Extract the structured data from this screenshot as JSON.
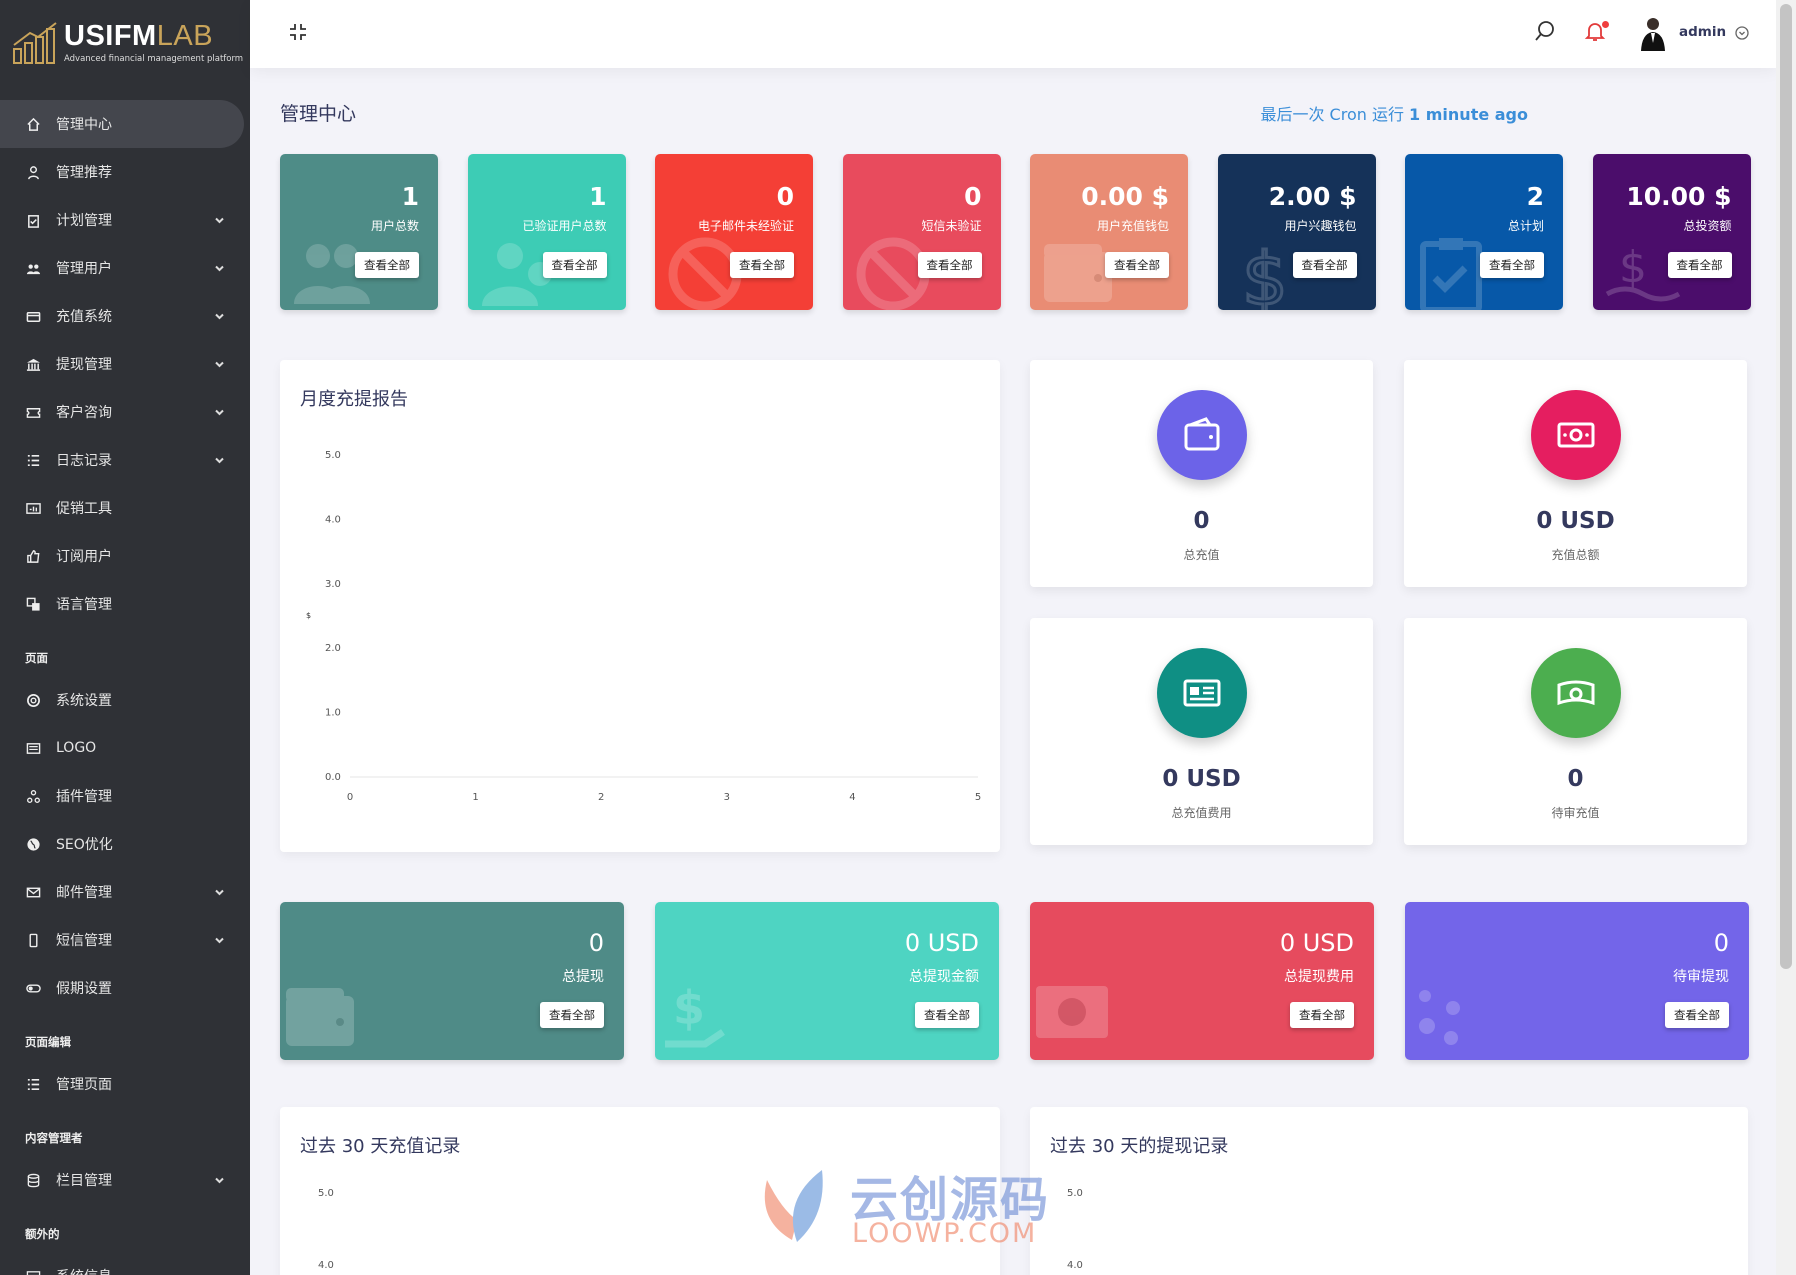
{
  "brand": {
    "name_a": "USIFM",
    "name_b": "LAB",
    "tagline": "Advanced financial management platform"
  },
  "sidebar": {
    "items": [
      {
        "label": "管理中心",
        "icon": "home-icon",
        "active": true,
        "chevron": false
      },
      {
        "label": "管理推荐",
        "icon": "referral-icon",
        "chevron": false
      },
      {
        "label": "计划管理",
        "icon": "clipboard-icon",
        "chevron": true
      },
      {
        "label": "管理用户",
        "icon": "users-icon",
        "chevron": true
      },
      {
        "label": "充值系统",
        "icon": "card-icon",
        "chevron": true
      },
      {
        "label": "提现管理",
        "icon": "bank-icon",
        "chevron": true
      },
      {
        "label": "客户咨询",
        "icon": "ticket-icon",
        "chevron": true
      },
      {
        "label": "日志记录",
        "icon": "list-icon",
        "chevron": true
      },
      {
        "label": "促销工具",
        "icon": "promo-icon",
        "chevron": false
      },
      {
        "label": "订阅用户",
        "icon": "thumbs-up-icon",
        "chevron": false
      },
      {
        "label": "语言管理",
        "icon": "language-icon",
        "chevron": false
      }
    ],
    "section_pages": "页面",
    "pages_items": [
      {
        "label": "系统设置",
        "icon": "lifebuoy-icon",
        "chevron": false
      },
      {
        "label": "LOGO",
        "icon": "image-icon",
        "chevron": false
      },
      {
        "label": "插件管理",
        "icon": "plugin-icon",
        "chevron": false
      },
      {
        "label": "SEO优化",
        "icon": "globe-icon",
        "chevron": false
      },
      {
        "label": "邮件管理",
        "icon": "mail-icon",
        "chevron": true
      },
      {
        "label": "短信管理",
        "icon": "phone-icon",
        "chevron": true
      },
      {
        "label": "假期设置",
        "icon": "toggle-icon",
        "chevron": false
      }
    ],
    "section_editor": "页面编辑",
    "editor_items": [
      {
        "label": "管理页面",
        "icon": "list-icon",
        "chevron": false
      }
    ],
    "section_content": "内容管理者",
    "content_items": [
      {
        "label": "栏目管理",
        "icon": "database-icon",
        "chevron": true
      }
    ],
    "section_extra": "额外的",
    "extra_items": [
      {
        "label": "系统信息",
        "icon": "server-icon",
        "chevron": false
      }
    ]
  },
  "topbar": {
    "user": "admin"
  },
  "page": {
    "title": "管理中心",
    "cron_prefix": "最后一次 Cron 运行 ",
    "cron_time": "1 minute ago"
  },
  "view_all": "查看全部",
  "stats": [
    {
      "value": "1",
      "label": "用户总数",
      "color": "#4e8c87",
      "icon": "users-icon"
    },
    {
      "value": "1",
      "label": "已验证用户总数",
      "color": "#3dccb5",
      "icon": "user-check-icon"
    },
    {
      "value": "0",
      "label": "电子邮件未经验证",
      "color": "#f43f36",
      "icon": "ban-icon"
    },
    {
      "value": "0",
      "label": "短信未验证",
      "color": "#e84b5d",
      "icon": "ban-icon"
    },
    {
      "value": "0.00 $",
      "label": "用户充值钱包",
      "color": "#e98c74",
      "icon": "wallet-icon"
    },
    {
      "value": "2.00 $",
      "label": "用户兴趣钱包",
      "color": "#153259",
      "icon": "dollar-icon"
    },
    {
      "value": "2",
      "label": "总计划",
      "color": "#0758a8",
      "icon": "clipboard-icon"
    },
    {
      "value": "10.00 $",
      "label": "总投资额",
      "color": "#4b0d6b",
      "icon": "money-hand-icon"
    }
  ],
  "monthly": {
    "title": "月度充提报告",
    "yaxis_unit": "$"
  },
  "chart_data": {
    "type": "line",
    "title": "月度充提报告",
    "x": [
      0,
      1,
      2,
      3,
      4,
      5
    ],
    "yticks": [
      0.0,
      1.0,
      2.0,
      3.0,
      4.0,
      5.0
    ],
    "ylim": [
      0,
      5
    ],
    "xlim": [
      0,
      5
    ],
    "ylabel": "$",
    "series": []
  },
  "minis": [
    {
      "value": "0",
      "label": "总充值",
      "color": "#6c63e8",
      "icon": "wallet-icon"
    },
    {
      "value": "0 USD",
      "label": "充值总额",
      "color": "#e51e60",
      "icon": "money-icon"
    },
    {
      "value": "0 USD",
      "label": "总充值费用",
      "color": "#0f8f84",
      "icon": "id-card-icon"
    },
    {
      "value": "0",
      "label": "待审充值",
      "color": "#4cae4f",
      "icon": "cash-icon"
    }
  ],
  "wstats": [
    {
      "value": "0",
      "label": "总提现",
      "color": "#4f8b87",
      "icon": "wallet-icon"
    },
    {
      "value": "0 USD",
      "label": "总提现金额",
      "color": "#4ed4c2",
      "icon": "dollar-hand-icon"
    },
    {
      "value": "0 USD",
      "label": "总提现费用",
      "color": "#e64b5e",
      "icon": "money-icon"
    },
    {
      "value": "0",
      "label": "待审提现",
      "color": "#7365e9",
      "icon": "spinner-icon"
    }
  ],
  "deposit30": {
    "title": "过去 30 天充值记录",
    "yticks": [
      "5.0",
      "4.0"
    ]
  },
  "withdraw30": {
    "title": "过去 30 天的提现记录",
    "yticks": [
      "5.0",
      "4.0"
    ]
  },
  "watermark": {
    "cn": "云创源码",
    "url": "LOOWP.COM"
  }
}
